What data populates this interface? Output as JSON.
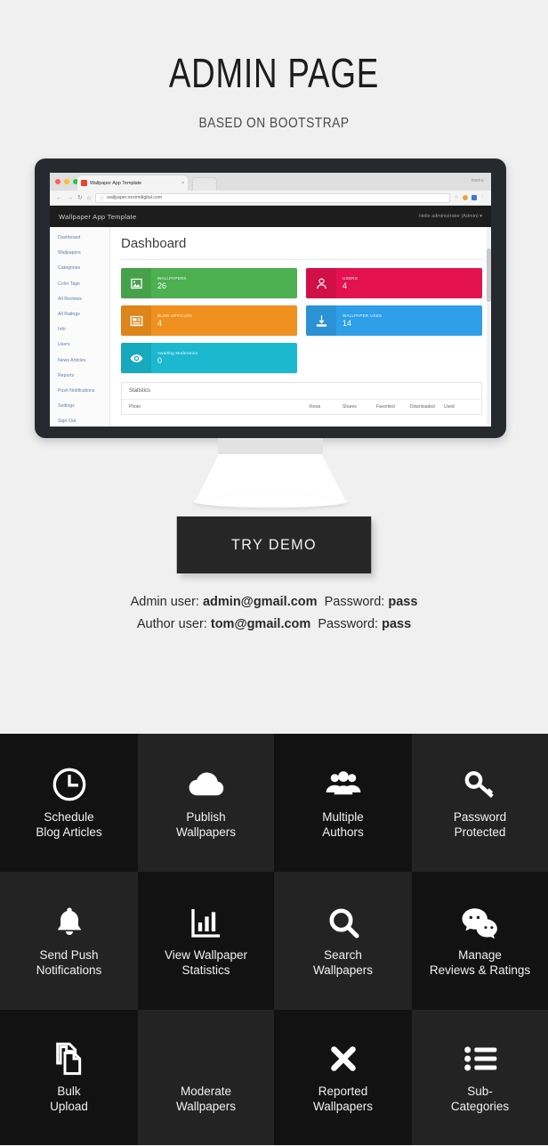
{
  "hero": {
    "title": "ADMIN PAGE",
    "subtitle": "BASED ON BOOTSTRAP"
  },
  "browser": {
    "tab_title": "Wallpaper App Template",
    "tab_close": "×",
    "menu_label": "menu",
    "url": "wallpaper.neximdigital.com",
    "back_icon": "←",
    "forward_icon": "→",
    "reload_icon": "↻",
    "home_icon": "⌂",
    "lock_icon": "ⓘ",
    "star_icon": "☆",
    "overflow_icon": "⋮"
  },
  "app": {
    "brand": "Wallpaper App Template",
    "user_menu": "Hello administrator (Admin) ▾",
    "page_title": "Dashboard",
    "sidebar": [
      "Dashboard",
      "Wallpapers",
      "Categories",
      "Color Tags",
      "All Reviews",
      "All Ratings",
      "Info",
      "Users",
      "News Articles",
      "Reports",
      "Push Notifications",
      "Settings",
      "Sign Out"
    ],
    "cards": [
      {
        "label": "WALLPAPERS",
        "value": "26",
        "color": "#4caf50",
        "icon": "image-icon"
      },
      {
        "label": "BLOG ARTICLES",
        "value": "4",
        "color": "#f0901e",
        "icon": "newspaper-icon"
      },
      {
        "label": "Awaiting Moderation",
        "value": "0",
        "color": "#1bb8d0",
        "icon": "eye-icon"
      },
      {
        "label": "USERS",
        "value": "4",
        "color": "#e3124f",
        "icon": "user-icon"
      },
      {
        "label": "WALLPAPER USES",
        "value": "14",
        "color": "#2e9fe8",
        "icon": "download-icon"
      }
    ],
    "statistics": {
      "heading": "Statistics",
      "columns": [
        "Photo",
        "Views",
        "Shares",
        "Favorited",
        "Downloaded",
        "Used"
      ]
    }
  },
  "demo": {
    "button": "TRY DEMO",
    "admin_prefix": "Admin user:",
    "admin_user": "admin@gmail.com",
    "admin_pass_prefix": "Password:",
    "admin_pass": "pass",
    "author_prefix": "Author user:",
    "author_user": "tom@gmail.com",
    "author_pass_prefix": "Password:",
    "author_pass": "pass"
  },
  "features": [
    {
      "label": "Schedule\nBlog Articles",
      "icon": "clock-icon",
      "shade": "dark"
    },
    {
      "label": "Publish\nWallpapers",
      "icon": "cloud-upload-icon",
      "shade": "light"
    },
    {
      "label": "Multiple\nAuthors",
      "icon": "users-icon",
      "shade": "dark"
    },
    {
      "label": "Password\nProtected",
      "icon": "key-icon",
      "shade": "light"
    },
    {
      "label": "Send Push\nNotifications",
      "icon": "bell-icon",
      "shade": "light"
    },
    {
      "label": "View Wallpaper\nStatistics",
      "icon": "bar-chart-icon",
      "shade": "dark"
    },
    {
      "label": "Search\nWallpapers",
      "icon": "search-icon",
      "shade": "light"
    },
    {
      "label": "Manage\nReviews & Ratings",
      "icon": "comments-icon",
      "shade": "dark"
    },
    {
      "label": "Bulk\nUpload",
      "icon": "copy-icon",
      "shade": "dark"
    },
    {
      "label": "Moderate\nWallpapers",
      "icon": "eye-icon",
      "shade": "light"
    },
    {
      "label": "Reported\nWallpapers",
      "icon": "times-icon",
      "shade": "dark"
    },
    {
      "label": "Sub-\nCategories",
      "icon": "list-icon",
      "shade": "light"
    }
  ],
  "colors": {
    "page_bg": "#f0f0f0",
    "tile_dark": "#121212",
    "tile_light": "#232323",
    "button_bg": "#262626",
    "monitor_bezel": "#262a2e"
  }
}
